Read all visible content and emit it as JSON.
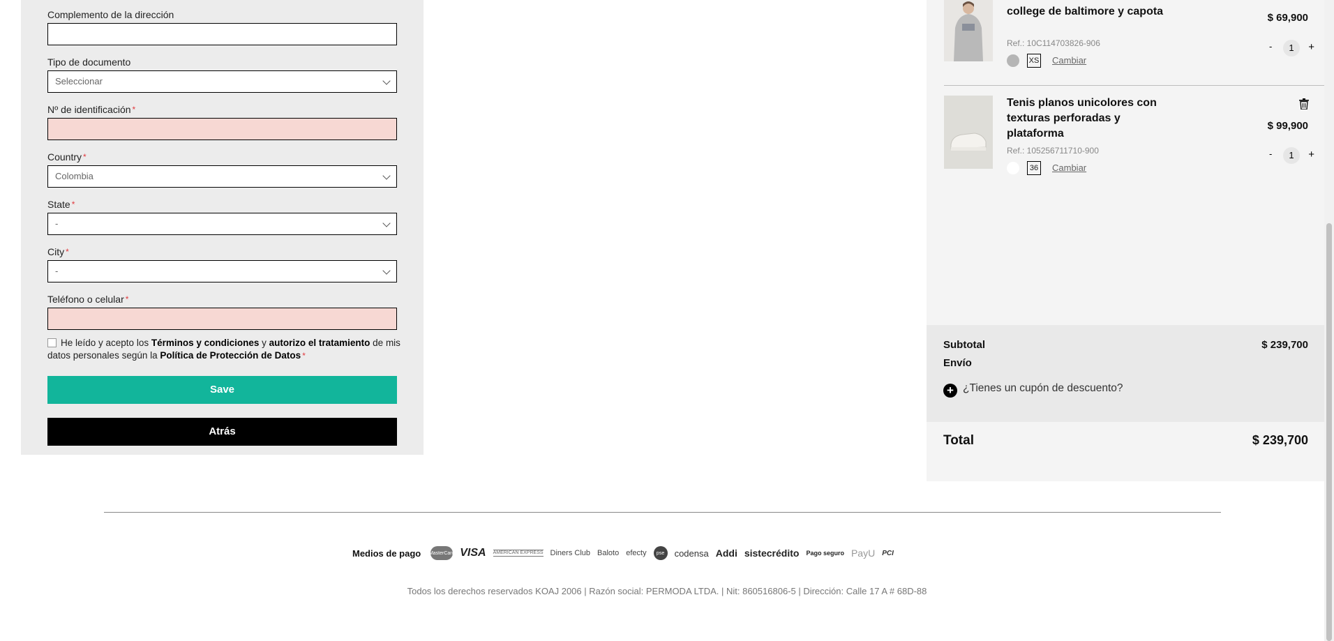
{
  "form": {
    "complemento": {
      "label": "Complemento de la dirección",
      "value": ""
    },
    "tipo_documento": {
      "label": "Tipo de documento",
      "value": "Seleccionar"
    },
    "identificacion": {
      "label": "Nº de identificación",
      "required": "*",
      "value": ""
    },
    "country": {
      "label": "Country",
      "required": "*",
      "value": "Colombia"
    },
    "state": {
      "label": "State",
      "required": "*",
      "value": "-"
    },
    "city": {
      "label": "City",
      "required": "*",
      "value": "-"
    },
    "telefono": {
      "label": "Teléfono o celular",
      "required": "*",
      "value": ""
    },
    "terms": {
      "part1": "He leído y acepto los ",
      "terms_link": "Términos y condiciones",
      "part2": " y ",
      "authorize": "autorizo el tratamiento",
      "part3": " de mis datos personales según la ",
      "policy_link": "Política de Protección de Datos",
      "required": "*"
    },
    "save_label": "Save",
    "back_label": "Atrás"
  },
  "cart": {
    "items": [
      {
        "title": "college de baltimore y capota",
        "ref": "Ref.: 10C114703826-906",
        "price": "$ 69,900",
        "size": "XS",
        "change_label": "Cambiar",
        "qty": "1",
        "color": "#b5b5b5"
      },
      {
        "title": "Tenis planos unicolores con texturas perforadas y plataforma",
        "ref": "Ref.: 105256711710-900",
        "price": "$ 99,900",
        "size": "36",
        "change_label": "Cambiar",
        "qty": "1",
        "color": "#ffffff"
      }
    ],
    "qty_minus": "-",
    "qty_plus": "+",
    "summary": {
      "subtotal_label": "Subtotal",
      "subtotal_value": "$ 239,700",
      "shipping_label": "Envío",
      "coupon_label": "¿Tienes un cupón de descuento?",
      "total_label": "Total",
      "total_value": "$ 239,700"
    }
  },
  "footer": {
    "payments_label": "Medios de pago",
    "logos": {
      "mastercard": "MasterCard",
      "visa": "VISA",
      "amex": "AMERICAN EXPRESS",
      "diners": "Diners Club",
      "baloto": "Baloto",
      "efecty": "efecty",
      "pse": "pse",
      "codensa": "codensa",
      "addi": "Addi",
      "sistecredito": "sistecrédito",
      "pago_seguro": "Pago seguro",
      "payu": "PayU",
      "pci": "PCI"
    },
    "copyright": "Todos los derechos reservados KOAJ 2006 | Razón social: PERMODA LTDA. | Nit: 860516806-5 | Dirección: Calle 17 A # 68D-88"
  }
}
